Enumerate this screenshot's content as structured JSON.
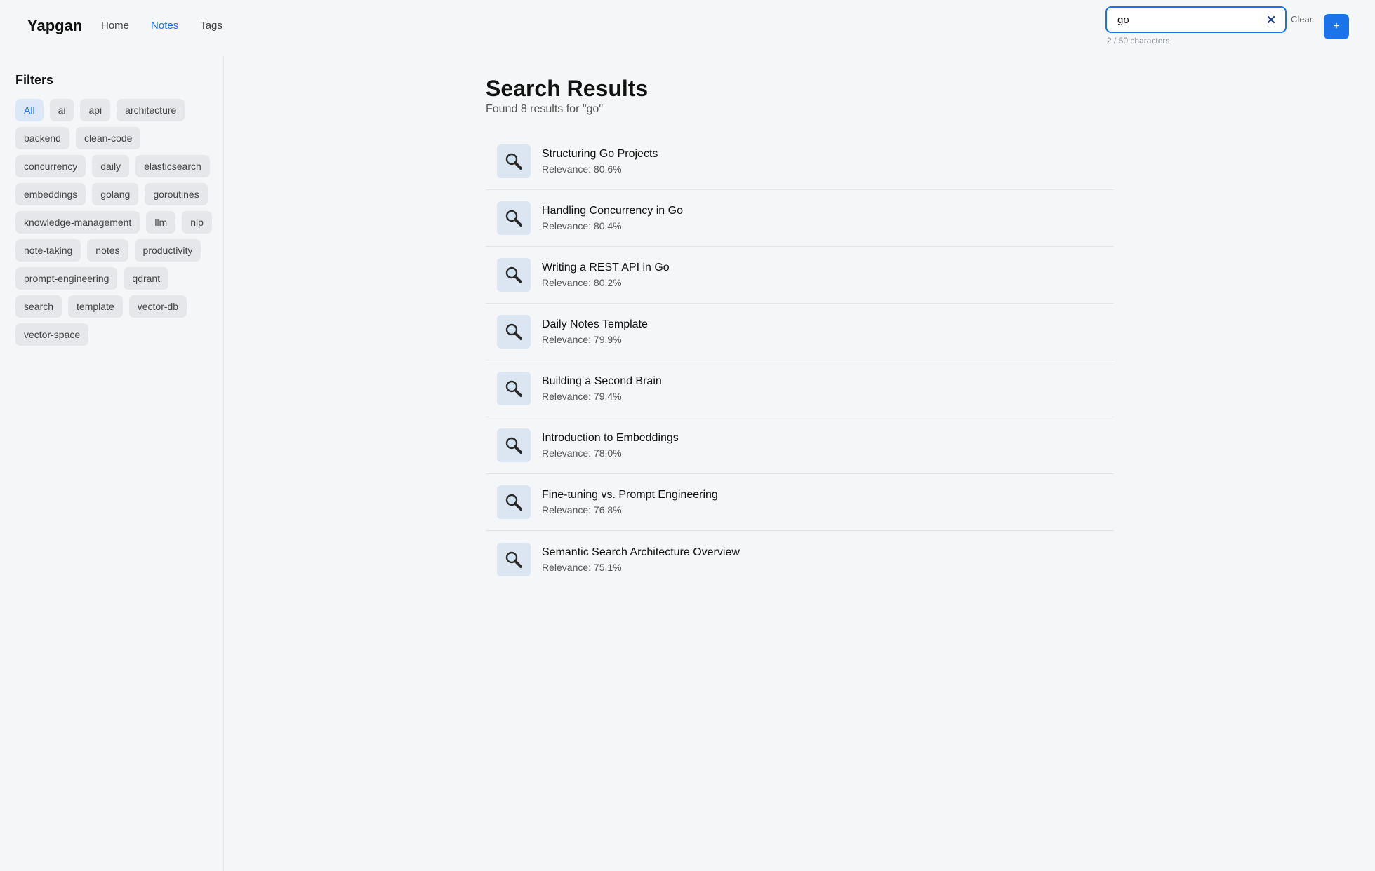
{
  "header": {
    "brand": "Yapgan",
    "nav": [
      {
        "label": "Home",
        "active": false
      },
      {
        "label": "Notes",
        "active": true
      },
      {
        "label": "Tags",
        "active": false
      }
    ],
    "search": {
      "value": "go",
      "char_count": "2 / 50 characters",
      "clear_icon": "close-icon"
    },
    "clear_label": "Clear",
    "add_label": "+",
    "accent_color": "#1a73e8"
  },
  "sidebar": {
    "title": "Filters",
    "tags": [
      {
        "label": "All",
        "active": true
      },
      {
        "label": "ai"
      },
      {
        "label": "api"
      },
      {
        "label": "architecture"
      },
      {
        "label": "backend"
      },
      {
        "label": "clean-code"
      },
      {
        "label": "concurrency"
      },
      {
        "label": "daily"
      },
      {
        "label": "elasticsearch"
      },
      {
        "label": "embeddings"
      },
      {
        "label": "golang"
      },
      {
        "label": "goroutines"
      },
      {
        "label": "knowledge-management"
      },
      {
        "label": "llm"
      },
      {
        "label": "nlp"
      },
      {
        "label": "note-taking"
      },
      {
        "label": "notes"
      },
      {
        "label": "productivity"
      },
      {
        "label": "prompt-engineering"
      },
      {
        "label": "qdrant"
      },
      {
        "label": "search"
      },
      {
        "label": "template"
      },
      {
        "label": "vector-db"
      },
      {
        "label": "vector-space"
      }
    ]
  },
  "main": {
    "title": "Search Results",
    "summary": "Found 8 results for \"go\"",
    "results": [
      {
        "title": "Structuring Go Projects",
        "relevance": "Relevance: 80.6%",
        "icon": "magnifier-icon"
      },
      {
        "title": "Handling Concurrency in Go",
        "relevance": "Relevance: 80.4%",
        "icon": "magnifier-icon"
      },
      {
        "title": "Writing a REST API in Go",
        "relevance": "Relevance: 80.2%",
        "icon": "magnifier-icon"
      },
      {
        "title": "Daily Notes Template",
        "relevance": "Relevance: 79.9%",
        "icon": "magnifier-icon"
      },
      {
        "title": "Building a Second Brain",
        "relevance": "Relevance: 79.4%",
        "icon": "magnifier-icon"
      },
      {
        "title": "Introduction to Embeddings",
        "relevance": "Relevance: 78.0%",
        "icon": "magnifier-icon"
      },
      {
        "title": "Fine-tuning vs. Prompt Engineering",
        "relevance": "Relevance: 76.8%",
        "icon": "magnifier-icon"
      },
      {
        "title": "Semantic Search Architecture Overview",
        "relevance": "Relevance: 75.1%",
        "icon": "magnifier-icon"
      }
    ]
  }
}
